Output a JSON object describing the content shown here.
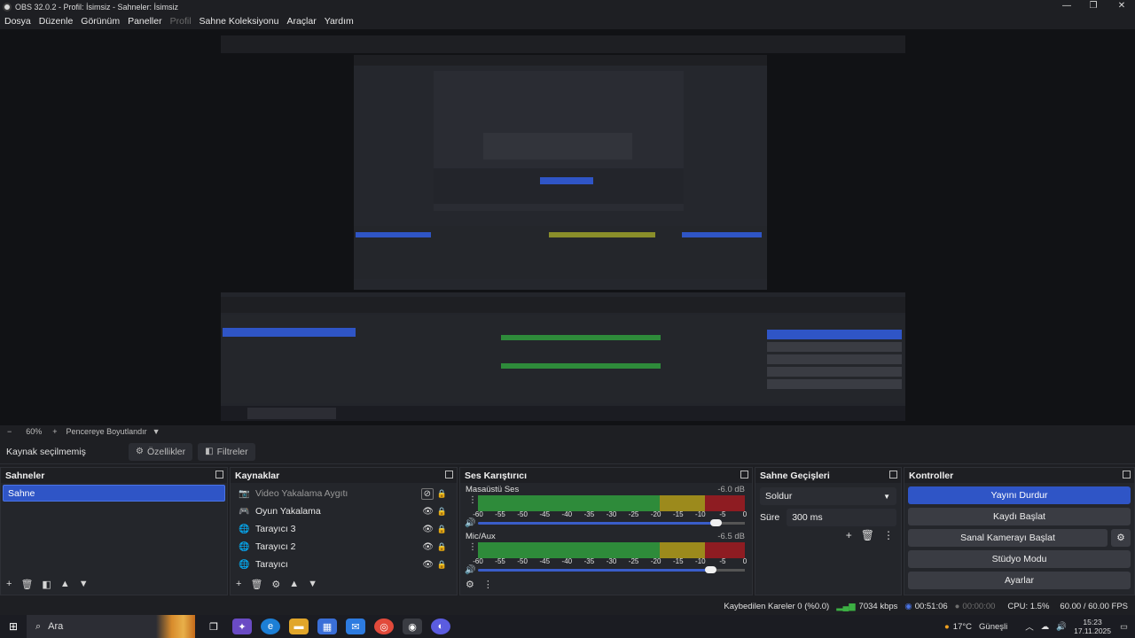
{
  "window": {
    "title": "OBS 32.0.2 - Profil: İsimsiz - Sahneler: İsimsiz",
    "minimize": "—",
    "maximize": "❐",
    "close": "✕"
  },
  "menu": [
    {
      "label": "Dosya",
      "enabled": true
    },
    {
      "label": "Düzenle",
      "enabled": true
    },
    {
      "label": "Görünüm",
      "enabled": true
    },
    {
      "label": "Paneller",
      "enabled": true
    },
    {
      "label": "Profil",
      "enabled": false
    },
    {
      "label": "Sahne Koleksiyonu",
      "enabled": true
    },
    {
      "label": "Araçlar",
      "enabled": true
    },
    {
      "label": "Yardım",
      "enabled": true
    }
  ],
  "zoombar": {
    "minus": "−",
    "zoom": "60%",
    "plus": "+",
    "fit": "Pencereye Boyutlandır"
  },
  "source_toolbar": {
    "selection": "Kaynak seçilmemiş",
    "properties": "Özellikler",
    "filters": "Filtreler"
  },
  "scenes": {
    "title": "Sahneler",
    "items": [
      "Sahne"
    ]
  },
  "sources": {
    "title": "Kaynaklar",
    "items": [
      {
        "name": "Video Yakalama Aygıtı",
        "icon": "camera-icon",
        "dim": true
      },
      {
        "name": "Oyun Yakalama",
        "icon": "gamepad-icon",
        "dim": false
      },
      {
        "name": "Tarayıcı 3",
        "icon": "globe-icon",
        "dim": false
      },
      {
        "name": "Tarayıcı 2",
        "icon": "globe-icon",
        "dim": false
      },
      {
        "name": "Tarayıcı",
        "icon": "globe-icon",
        "dim": false
      }
    ]
  },
  "mixer": {
    "title": "Ses Karıştırıcı",
    "ticks": [
      "-60",
      "-55",
      "-50",
      "-45",
      "-40",
      "-35",
      "-30",
      "-25",
      "-20",
      "-15",
      "-10",
      "-5",
      "0"
    ],
    "channels": [
      {
        "name": "Masaüstü Ses",
        "db": "-6.0 dB",
        "volume": 0.89
      },
      {
        "name": "Mic/Aux",
        "db": "-6.5 dB",
        "volume": 0.87
      }
    ]
  },
  "transitions": {
    "title": "Sahne Geçişleri",
    "selected": "Soldur",
    "duration_label": "Süre",
    "duration_value": "300 ms"
  },
  "controls": {
    "title": "Kontroller",
    "stop_stream": "Yayını Durdur",
    "start_record": "Kaydı Başlat",
    "virtual_cam": "Sanal Kamerayı Başlat",
    "studio_mode": "Stüdyo Modu",
    "settings": "Ayarlar"
  },
  "status": {
    "dropped_frames": "Kaybedilen Kareler 0 (%0.0)",
    "bitrate": "7034 kbps",
    "stream_time": "00:51:06",
    "record_time": "00:00:00",
    "cpu": "CPU: 1.5%",
    "fps": "60.00 / 60.00 FPS"
  },
  "taskbar": {
    "search": "Ara",
    "weather": "17°C",
    "weather_desc": "Güneşli",
    "time": "15:23",
    "date": "17.11.2025"
  },
  "colors": {
    "accent": "#2f55c6",
    "meter_green": "#2e8b3a",
    "meter_yellow": "#9c8a1c",
    "meter_red": "#8e1c22"
  }
}
